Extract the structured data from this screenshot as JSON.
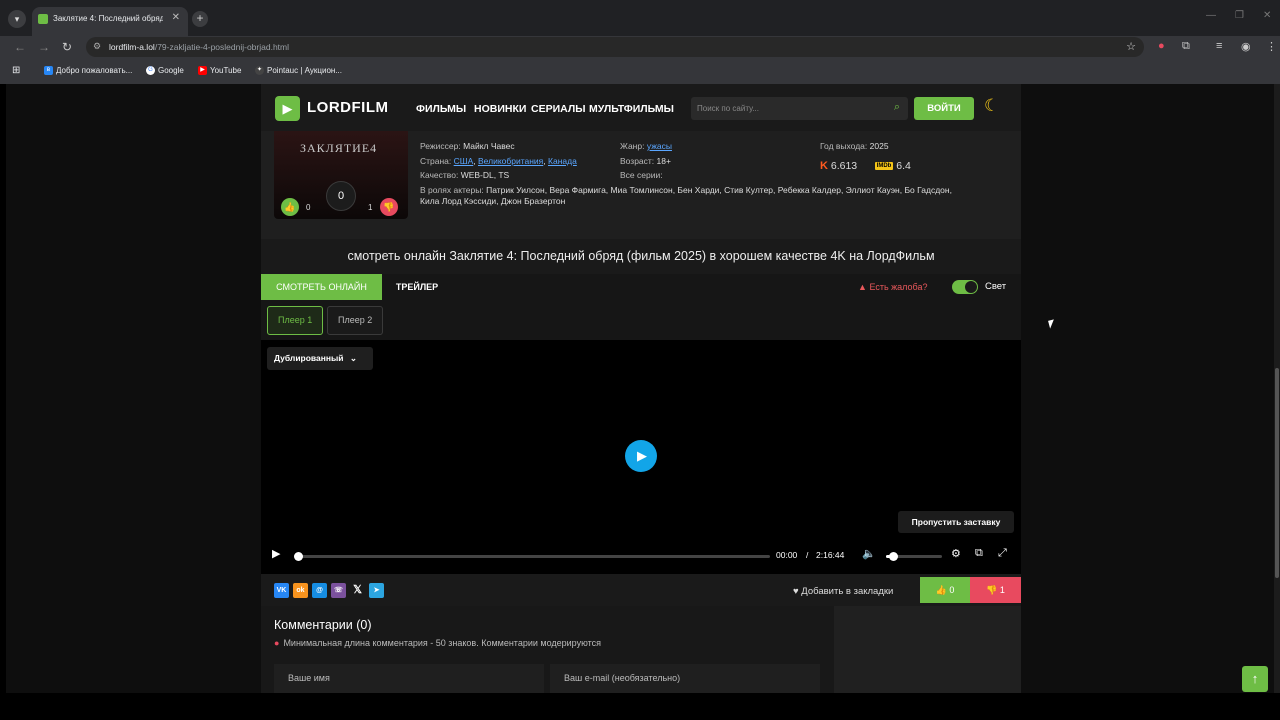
{
  "browser": {
    "tab_title": "Заклятие 4: Последний обряд",
    "url_host": "lordfilm-a.lol",
    "url_path": "/79-zakljatie-4-poslednij-obrjad.html",
    "bookmarks": [
      "Добро пожаловать...",
      "Google",
      "YouTube",
      "Pointauc | Аукцион..."
    ]
  },
  "site": {
    "logo": "LORDFILM",
    "nav": [
      "ФИЛЬМЫ",
      "НОВИНКИ",
      "СЕРИАЛЫ",
      "МУЛЬТФИЛЬМЫ"
    ],
    "search_placeholder": "Поиск по сайту...",
    "login": "ВОЙТИ"
  },
  "film": {
    "poster_title": "ЗАКЛЯТИЕ4",
    "likes": "0",
    "dislikes": "1",
    "center_count": "0",
    "director_label": "Режиссер:",
    "director": "Майкл Чавес",
    "country_label": "Страна:",
    "countries": [
      "США",
      "Великобритания",
      "Канада"
    ],
    "quality_label": "Качество:",
    "quality": "WEB-DL, TS",
    "genre_label": "Жанр:",
    "genre": "ужасы",
    "age_label": "Возраст:",
    "age": "18+",
    "series_label": "Все серии:",
    "year_label": "Год выхода:",
    "year": "2025",
    "kp_rating": "6.613",
    "imdb_rating": "6.4",
    "imdb_badge": "IMDb",
    "actors_label": "В ролях актеры:",
    "actors_line1": "Патрик Уилсон, Вера Фармига, Миа Томлинсон, Бен Харди, Стив Култер, Ребекка Калдер, Эллиот Кауэн, Бо Гадсдон,",
    "actors_line2": "Кила Лорд Кэссиди, Джон Бразертон"
  },
  "page_title": "смотреть онлайн Заклятие 4: Последний обряд (фильм 2025) в хорошем качестве 4K на ЛордФильм",
  "tabs": {
    "watch": "СМОТРЕТЬ ОНЛАЙН",
    "trailer": "ТРЕЙЛЕР",
    "complaint": "Есть жалоба?",
    "light": "Свет",
    "light_on": true
  },
  "players": [
    "Плеер 1",
    "Плеер 2"
  ],
  "video": {
    "audio_track": "Дублированный",
    "skip_intro": "Пропустить заставку",
    "current_time": "00:00",
    "separator": "/",
    "duration": "2:16:44",
    "progress": 0,
    "volume": 0.12
  },
  "share": {
    "bookmark": "Добавить в закладки",
    "likes": "0",
    "dislikes": "1"
  },
  "comments": {
    "title": "Комментарии (0)",
    "note": "Минимальная длина комментария - 50 знаков. Комментарии модерируются",
    "name_placeholder": "Ваше имя",
    "email_placeholder": "Ваш e-mail (необязательно)"
  },
  "colors": {
    "accent": "#6ebd45",
    "danger": "#e84a5f",
    "play": "#12a5e8"
  }
}
